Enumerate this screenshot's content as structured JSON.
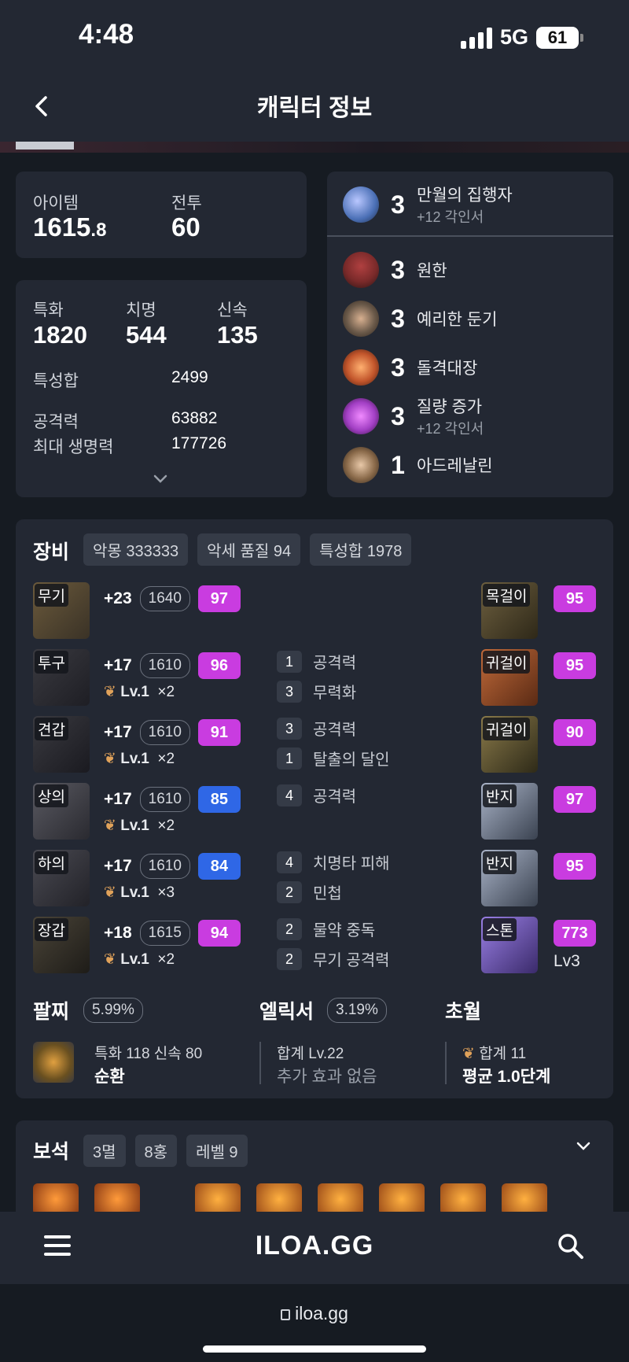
{
  "status": {
    "time": "4:48",
    "network": "5G",
    "battery": "61"
  },
  "header": {
    "back_icon": "chevron-left-icon",
    "title": "캐릭터 정보"
  },
  "summary": {
    "item_label": "아이템",
    "item_value": "1615",
    "item_decimal": ".8",
    "combat_label": "전투",
    "combat_value": "60"
  },
  "stats": {
    "spec_label": "특화",
    "spec_value": "1820",
    "crit_label": "치명",
    "crit_value": "544",
    "swift_label": "신속",
    "swift_value": "135",
    "total_label": "특성합",
    "total_value": "2499",
    "atk_label": "공격력",
    "atk_value": "63882",
    "hp_label": "최대 생명력",
    "hp_value": "177726",
    "expand_icon": "chevron-down-icon"
  },
  "engravings": [
    {
      "level": "3",
      "name": "만월의 집행자",
      "sub": "+12 각인서",
      "color": "#4a6fb5"
    },
    {
      "level": "3",
      "name": "원한",
      "sub": "",
      "color": "#7a2a2a"
    },
    {
      "level": "3",
      "name": "예리한 둔기",
      "sub": "",
      "color": "#6b5a4a"
    },
    {
      "level": "3",
      "name": "돌격대장",
      "sub": "",
      "color": "#c2552b"
    },
    {
      "level": "3",
      "name": "질량 증가",
      "sub": "+12 각인서",
      "color": "#a23fc4"
    },
    {
      "level": "1",
      "name": "아드레날린",
      "sub": "",
      "color": "#8a6a4a"
    }
  ],
  "equipment": {
    "title": "장비",
    "chips": [
      "악몽 333333",
      "악세 품질 94",
      "특성합 1978"
    ],
    "gear": [
      {
        "slot": "무기",
        "enhance": "+23",
        "ilvl": "1640",
        "quality": "97",
        "qcolor": "pink",
        "bonus": "",
        "mult": ""
      },
      {
        "slot": "투구",
        "enhance": "+17",
        "ilvl": "1610",
        "quality": "96",
        "qcolor": "pink",
        "bonus": "Lv.1",
        "mult": "×2"
      },
      {
        "slot": "견갑",
        "enhance": "+17",
        "ilvl": "1610",
        "quality": "91",
        "qcolor": "pink",
        "bonus": "Lv.1",
        "mult": "×2"
      },
      {
        "slot": "상의",
        "enhance": "+17",
        "ilvl": "1610",
        "quality": "85",
        "qcolor": "blue",
        "bonus": "Lv.1",
        "mult": "×2"
      },
      {
        "slot": "하의",
        "enhance": "+17",
        "ilvl": "1610",
        "quality": "84",
        "qcolor": "blue",
        "bonus": "Lv.1",
        "mult": "×3"
      },
      {
        "slot": "장갑",
        "enhance": "+18",
        "ilvl": "1615",
        "quality": "94",
        "qcolor": "pink",
        "bonus": "Lv.1",
        "mult": "×2"
      }
    ],
    "options": [
      {
        "num": "1",
        "text": "공격력"
      },
      {
        "num": "3",
        "text": "무력화"
      },
      {
        "num": "3",
        "text": "공격력"
      },
      {
        "num": "1",
        "text": "탈출의 달인"
      },
      {
        "num": "4",
        "text": "공격력"
      },
      {
        "num": "4",
        "text": "치명타 피해"
      },
      {
        "num": "2",
        "text": "민첩"
      },
      {
        "num": "2",
        "text": "물약 중독"
      },
      {
        "num": "2",
        "text": "무기 공격력"
      }
    ],
    "accessories": [
      {
        "slot": "목걸이",
        "quality": "95"
      },
      {
        "slot": "귀걸이",
        "quality": "95"
      },
      {
        "slot": "귀걸이",
        "quality": "90"
      },
      {
        "slot": "반지",
        "quality": "97"
      },
      {
        "slot": "반지",
        "quality": "95"
      },
      {
        "slot": "스톤",
        "quality": "773",
        "level": "Lv3"
      }
    ]
  },
  "bracelet": {
    "title": "팔찌",
    "percent": "5.99%",
    "stats": "특화 118  신속 80",
    "effect": "순환"
  },
  "elixir": {
    "title": "엘릭서",
    "percent": "3.19%",
    "total": "합계 Lv.22",
    "effect": "추가 효과 없음"
  },
  "transcend": {
    "title": "초월",
    "total": "합계 11",
    "avg": "평균 1.0단계"
  },
  "gems": {
    "title": "보석",
    "chips": [
      "3멸",
      "8홍",
      "레벨 9"
    ],
    "expand_icon": "chevron-down-icon"
  },
  "bottom_nav": {
    "menu_icon": "hamburger-menu-icon",
    "logo": "ILOA.GG",
    "search_icon": "search-icon"
  },
  "browser": {
    "lock_icon": "lock-icon",
    "url": "iloa.gg"
  }
}
